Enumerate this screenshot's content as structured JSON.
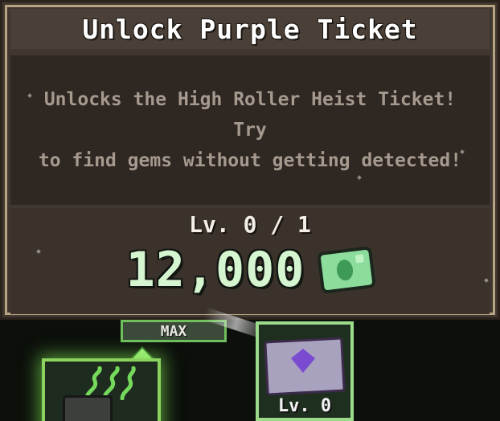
{
  "panel": {
    "title": "Unlock Purple Ticket",
    "description_line_1": "Unlocks the High Roller Heist Ticket! Try",
    "description_line_2": "to find gems without getting detected!",
    "level": "Lv. 0 / 1",
    "cost": "12,000",
    "currency_icon": "cash-icon"
  },
  "tree": {
    "max_label": "MAX",
    "left_node_icon": "jar-icon",
    "right_node_icon": "ticket-gem-icon",
    "right_node_level": "Lv. 0"
  },
  "colors": {
    "panel_bg": "#3f3730",
    "panel_border": "#b7a384",
    "cost_text": "#d5f5d0",
    "desc_text": "#a69a8f",
    "node_green": "#8bd35e",
    "ticket_purple": "#7a4ad0"
  }
}
